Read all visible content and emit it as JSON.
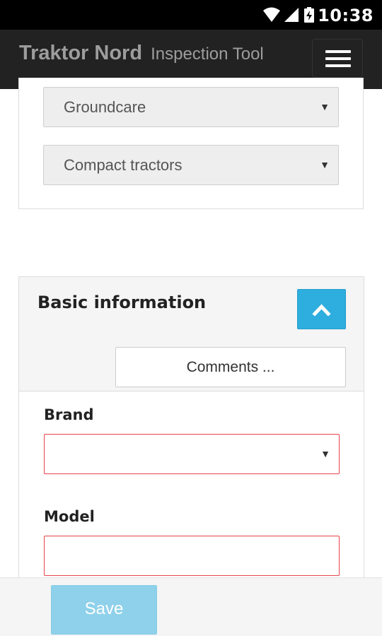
{
  "status_bar": {
    "time": "10:38",
    "icons": [
      "wifi-icon",
      "signal-icon",
      "battery-charging-icon"
    ]
  },
  "navbar": {
    "brand_main": "Traktor Nord",
    "brand_sub": "Inspection Tool",
    "menu_icon": "hamburger-menu-icon"
  },
  "filters": {
    "category_value": "Groundcare",
    "subcategory_value": "Compact tractors"
  },
  "basic_info": {
    "title": "Basic information",
    "collapse_icon": "chevron-up-icon",
    "comments_label": "Comments ...",
    "brand_label": "Brand",
    "brand_value": "",
    "model_label": "Model",
    "model_value": ""
  },
  "footer": {
    "save_label": "Save"
  },
  "colors": {
    "navbar_bg": "#222222",
    "accent": "#2eaede",
    "error_border": "#e8434b",
    "save_disabled": "#8fd1ea"
  }
}
